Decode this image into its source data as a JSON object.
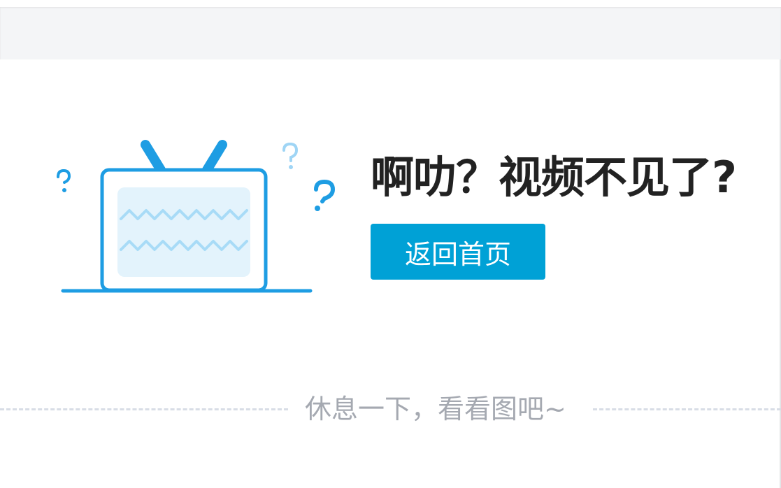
{
  "error": {
    "title": "啊叻？视频不见了?",
    "home_button_label": "返回首页",
    "divider_text": "休息一下，看看图吧~"
  },
  "colors": {
    "accent": "#00a1d6",
    "tv_stroke": "#1e9de3",
    "tv_screen": "#e3f3fc",
    "tv_wave": "#a8dbf7",
    "question_light": "#9fd5f5",
    "title_text": "#222222",
    "muted_text": "#a5a9b1",
    "topbar_bg": "#f4f5f7"
  },
  "icons": {
    "illustration": "confused-tv-icon"
  }
}
